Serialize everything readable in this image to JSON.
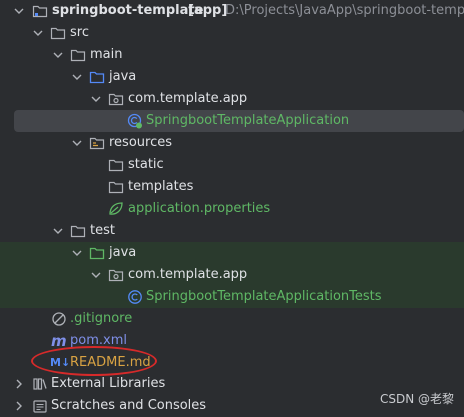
{
  "project": {
    "name": "springboot-template",
    "tag": "[app]",
    "path": "D:\\Projects\\JavaApp\\springboot-templ"
  },
  "tree": {
    "src": "src",
    "main": "main",
    "main_java": "java",
    "main_pkg": "com.template.app",
    "main_class": "SpringbootTemplateApplication",
    "resources": "resources",
    "static": "static",
    "templates": "templates",
    "app_props": "application.properties",
    "test": "test",
    "test_java": "java",
    "test_pkg": "com.template.app",
    "test_class": "SpringbootTemplateApplicationTests",
    "gitignore": ".gitignore",
    "pom": "pom.xml",
    "readme": "README.md",
    "readme_badge": "M↓",
    "pom_badge": "m",
    "external_libraries": "External Libraries",
    "scratches": "Scratches and Consoles"
  },
  "watermark": "CSDN @老黎",
  "colors": {
    "background": "#2b2d30",
    "selection": "#43454a",
    "test_band": "#2a3a2d",
    "folder_blue": "#548af7",
    "folder_green": "#5fb865",
    "annotation_red": "#d62a2a",
    "readme_orange": "#d9a343"
  },
  "icons": {
    "folder": "folder-icon",
    "source_folder": "source-folder-icon",
    "test_folder": "test-folder-icon",
    "package": "package-icon",
    "spring_class": "spring-class-icon",
    "test_class": "class-icon",
    "spring_leaf": "spring-leaf-icon",
    "ignore": "ignore-icon",
    "maven": "maven-icon",
    "markdown": "markdown-icon",
    "library": "library-icon",
    "scratches": "scratches-icon"
  }
}
